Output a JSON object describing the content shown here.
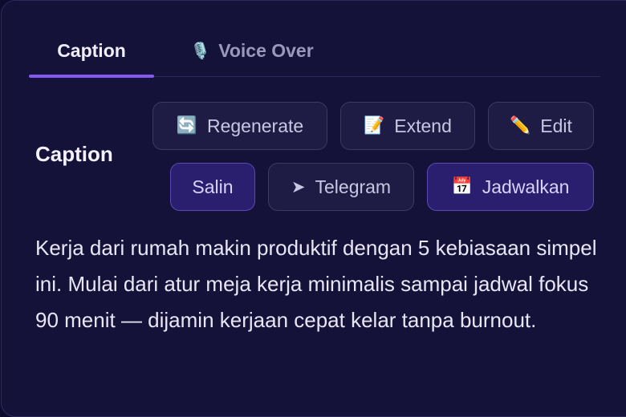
{
  "tabs": [
    {
      "label": "Caption",
      "icon": "",
      "active": true
    },
    {
      "label": "Voice Over",
      "icon": "🎙️",
      "active": false
    }
  ],
  "section": {
    "title": "Caption"
  },
  "actions": {
    "regenerate": {
      "label": "Regenerate",
      "icon": "🔄"
    },
    "extend": {
      "label": "Extend",
      "icon": "📝"
    },
    "edit": {
      "label": "Edit",
      "icon": "✏️"
    },
    "salin": {
      "label": "Salin"
    },
    "telegram": {
      "label": "Telegram",
      "icon": "➤"
    },
    "jadwalkan": {
      "label": "Jadwalkan",
      "icon": "📅"
    }
  },
  "caption": {
    "text": "Kerja dari rumah makin produktif dengan 5 kebiasaan simpel ini. Mulai dari atur meja kerja minimalis sampai jadwal fokus 90 menit — dijamin kerjaan cepat kelar tanpa burnout."
  },
  "colors": {
    "background": "#141238",
    "accent": "#8359f0",
    "button": "#1e1c44",
    "button_accent": "#2a1f6e"
  }
}
